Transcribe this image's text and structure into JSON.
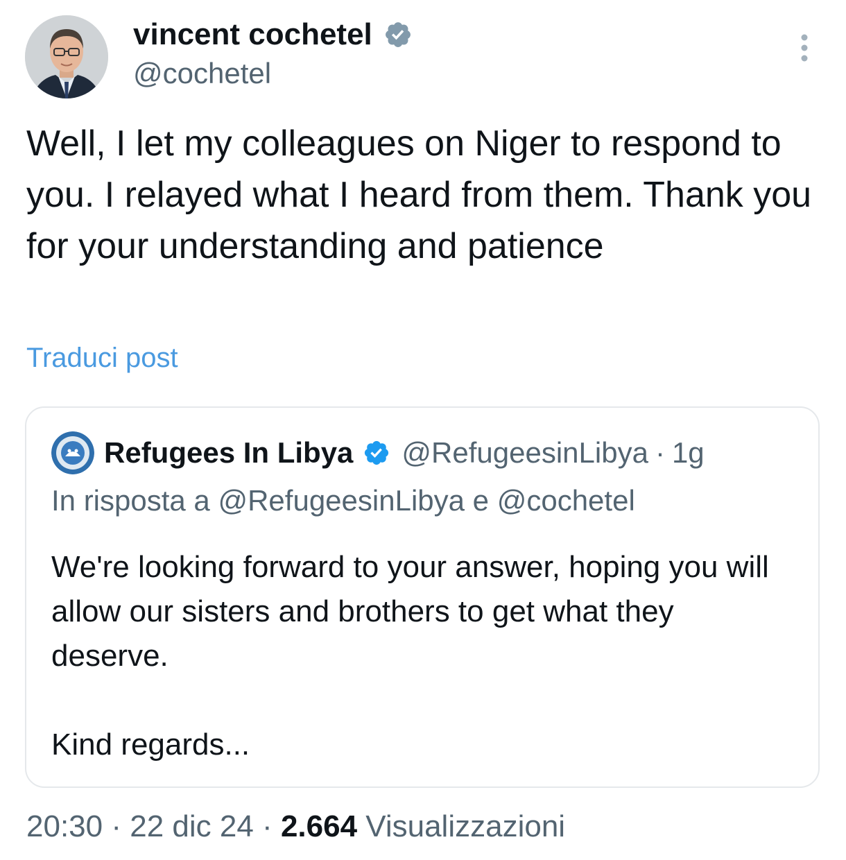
{
  "author": {
    "name": "vincent cochetel",
    "handle": "@cochetel"
  },
  "tweet": {
    "text": "Well, I let my colleagues on Niger to respond to you. I relayed what I heard from them. Thank you for your understanding and patience",
    "translate_label": "Traduci post",
    "time": "20:30",
    "separator": "·",
    "date": "22 dic 24",
    "views_count": "2.664",
    "views_label": "Visualizzazioni"
  },
  "quoted": {
    "name": "Refugees In Libya",
    "handle": "@RefugeesinLibya",
    "separator": "·",
    "age": "1g",
    "reply_prefix": "In risposta a",
    "reply_user_1": "@RefugeesinLibya",
    "reply_conjunction": "e",
    "reply_user_2": "@cochetel",
    "text": "We're looking forward to your answer, hoping you will allow our sisters and brothers to get what they deserve.",
    "regards": "Kind regards..."
  },
  "icons": {
    "verified": "verified-badge-icon",
    "more": "more-options-icon"
  },
  "colors": {
    "text_primary": "#0f1419",
    "text_secondary": "#536471",
    "link": "#4a9ae0",
    "verified": "#829aab",
    "verified_quoted": "#1d9bf0",
    "border": "#e5e8eb"
  }
}
